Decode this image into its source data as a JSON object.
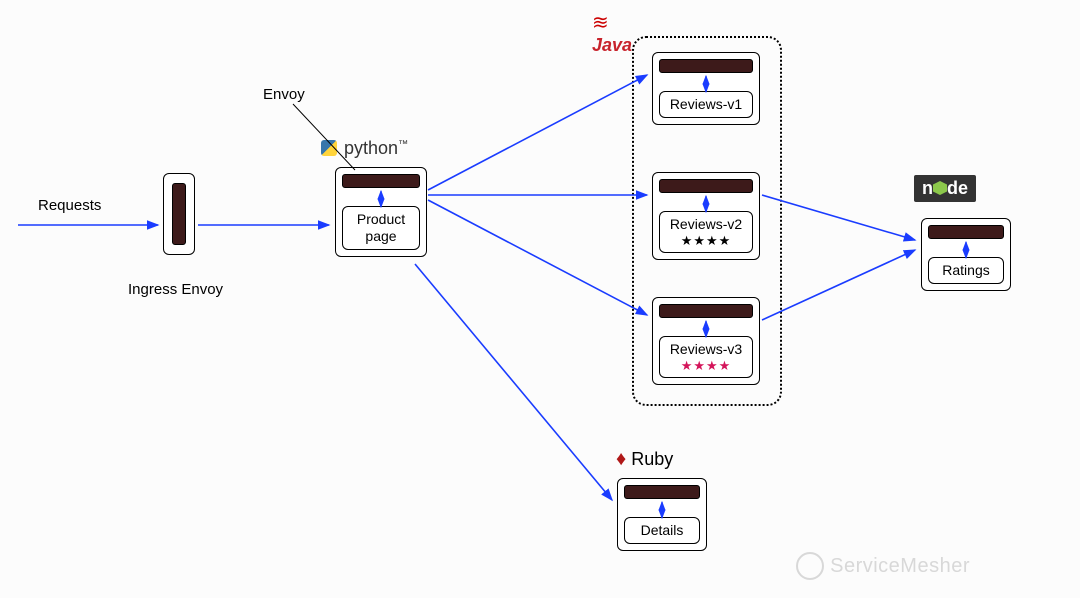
{
  "labels": {
    "requests": "Requests",
    "ingress": "Ingress Envoy",
    "envoy": "Envoy",
    "python": "python",
    "java": "Java",
    "ruby": "Ruby",
    "node": "node"
  },
  "services": {
    "product": "Product page",
    "reviews_v1": "Reviews-v1",
    "reviews_v2": "Reviews-v2",
    "reviews_v3": "Reviews-v3",
    "details": "Details",
    "ratings": "Ratings"
  },
  "stars": {
    "black": "★★★★",
    "red": "★★★★"
  },
  "watermark": "ServiceMesher",
  "colors": {
    "arrow": "#1a3cff",
    "star_red": "#d4145a"
  },
  "chart_data": {
    "type": "diagram",
    "title": "Istio Bookinfo Sample Application with Envoy Sidecars",
    "nodes": [
      {
        "id": "ingress",
        "name": "Ingress Envoy",
        "tech": "Envoy"
      },
      {
        "id": "productpage",
        "name": "Product page",
        "tech": "Python",
        "sidecar": "Envoy"
      },
      {
        "id": "reviews-v1",
        "name": "Reviews-v1",
        "tech": "Java",
        "sidecar": "Envoy",
        "rating_display": "none"
      },
      {
        "id": "reviews-v2",
        "name": "Reviews-v2",
        "tech": "Java",
        "sidecar": "Envoy",
        "rating_display": "black-stars"
      },
      {
        "id": "reviews-v3",
        "name": "Reviews-v3",
        "tech": "Java",
        "sidecar": "Envoy",
        "rating_display": "red-stars"
      },
      {
        "id": "details",
        "name": "Details",
        "tech": "Ruby",
        "sidecar": "Envoy"
      },
      {
        "id": "ratings",
        "name": "Ratings",
        "tech": "Node.js",
        "sidecar": "Envoy"
      }
    ],
    "edges": [
      {
        "from": "requests-client",
        "to": "ingress"
      },
      {
        "from": "ingress",
        "to": "productpage"
      },
      {
        "from": "productpage",
        "to": "reviews-v1"
      },
      {
        "from": "productpage",
        "to": "reviews-v2"
      },
      {
        "from": "productpage",
        "to": "reviews-v3"
      },
      {
        "from": "productpage",
        "to": "details"
      },
      {
        "from": "reviews-v2",
        "to": "ratings"
      },
      {
        "from": "reviews-v3",
        "to": "ratings"
      }
    ]
  }
}
